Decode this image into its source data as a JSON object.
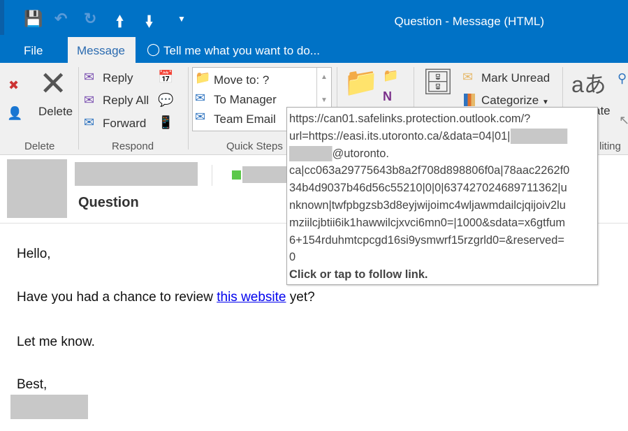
{
  "window": {
    "title": "Question - Message (HTML)"
  },
  "qat": {
    "save": "save-icon",
    "undo": "undo-icon",
    "redo": "redo-icon",
    "up": "arrow-up-icon",
    "down": "arrow-down-icon",
    "more": "customize-icon"
  },
  "tabs": {
    "file": "File",
    "message": "Message",
    "tell": "Tell me what you want to do..."
  },
  "ribbon": {
    "delete_group": {
      "label": "Delete",
      "delete": "Delete"
    },
    "respond_group": {
      "label": "Respond",
      "reply": "Reply",
      "reply_all": "Reply All",
      "forward": "Forward"
    },
    "quick_steps": {
      "label": "Quick Steps",
      "items": [
        "Move to: ?",
        "To Manager",
        "Team Email"
      ]
    },
    "tags": {
      "mark_unread": "Mark Unread",
      "categorize": "Categorize"
    },
    "translate_partial": "ate",
    "editing_partial": "liting"
  },
  "message": {
    "subject": "Question",
    "body": {
      "greeting": "Hello,",
      "line1_pre": "Have you had a chance to review ",
      "link": "this website",
      "line1_post": " yet?",
      "line2": "Let me know.",
      "closing": "Best,"
    }
  },
  "tooltip": {
    "lines": [
      "https://can01.safelinks.protection.outlook.com/?",
      "url=https://easi.its.utoronto.ca/&data=04|01|",
      "@utoronto.",
      "ca|cc063a29775643b8a2f708d898806f0a|78aac2262f0",
      "34b4d9037b46d56c55210|0|0|637427024689711362|u",
      "nknown|twfpbgzsb3d8eyjwijoimc4wljawmdailcjqijoiv2lu",
      "mziilcjbtii6ik1hawwilcjxvci6mn0=|1000&sdata=x6gtfum",
      "6+154rduhmtcpcgd16si9ysmwrf15rzgrld0=&reserved=",
      "0"
    ],
    "footer": "Click or tap to follow link."
  },
  "colors": {
    "accent": "#0072c6",
    "link": "#0000ee",
    "presence": "#5cc84a"
  }
}
